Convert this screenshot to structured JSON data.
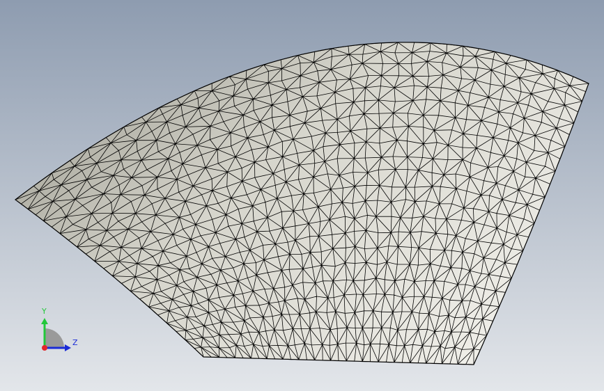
{
  "viewport": {
    "background_top": "#8e9cb0",
    "background_bottom": "#e3e6ea",
    "model": {
      "fill_light": "#f4f3ee",
      "fill_dark": "#a8a79c",
      "edge_color": "#000000"
    }
  },
  "triad": {
    "y_label": "Y",
    "z_label": "Z",
    "y_color": "#22c83a",
    "z_color": "#1a2bd6",
    "x_color": "#e3262b",
    "quadrant_color": "#9a9a9a"
  }
}
